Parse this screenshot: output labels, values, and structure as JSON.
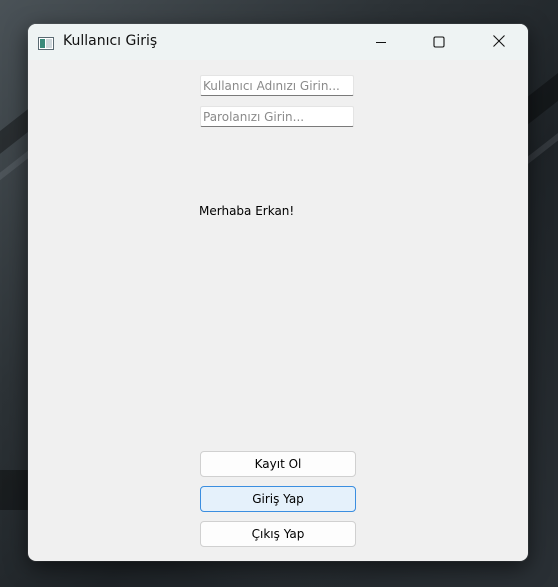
{
  "window": {
    "title": "Kullanıcı Giriş",
    "app_icon": "window-app-icon",
    "controls": {
      "minimize_icon": "minimize-icon",
      "maximize_icon": "maximize-icon",
      "close_icon": "close-icon"
    }
  },
  "form": {
    "username": {
      "value": "",
      "placeholder": "Kullanıcı Adınızı Girin..."
    },
    "password": {
      "value": "",
      "placeholder": "Parolanızı Girin..."
    },
    "greeting": "Merhaba Erkan!"
  },
  "buttons": {
    "register_label": "Kayıt Ol",
    "login_label": "Giriş Yap",
    "exit_label": "Çıkış Yap"
  },
  "colors": {
    "window_bg": "#f0f0f0",
    "titlebar_bg": "#eef3f3",
    "focused_button_border": "#3b8ee0",
    "focused_button_bg": "#e5f1fb"
  }
}
